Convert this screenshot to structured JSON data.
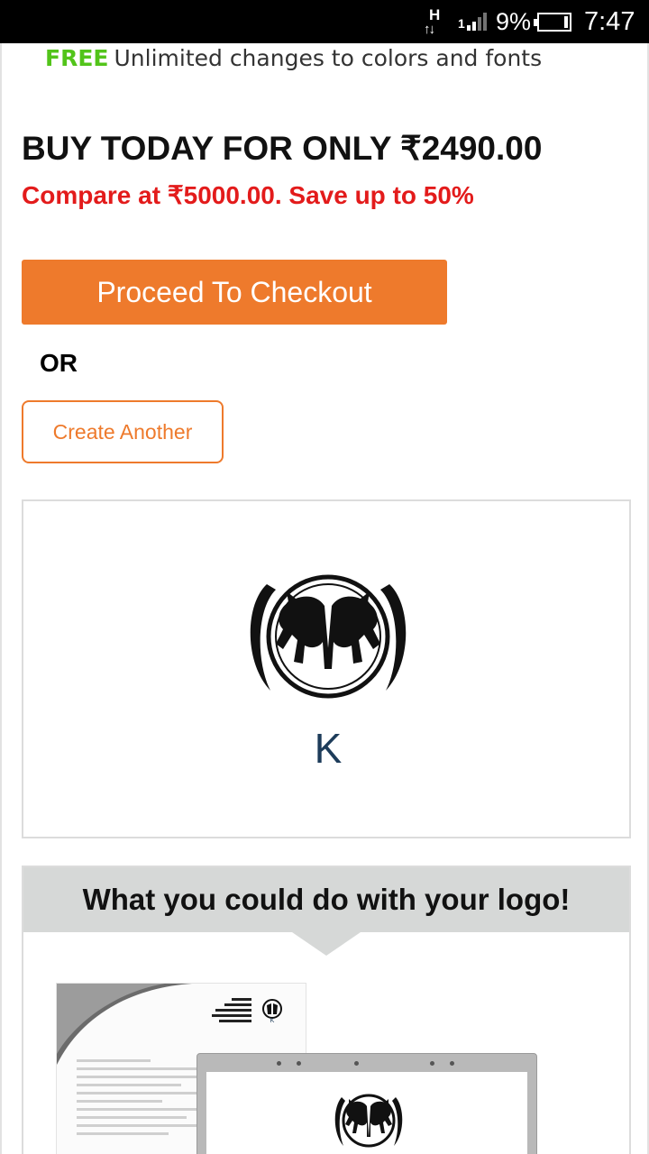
{
  "status_bar": {
    "network": "H",
    "signal_sub": "1",
    "battery_percent": "9%",
    "time": "7:47"
  },
  "promo": {
    "free_tag": "FREE",
    "free_text": "Unlimited changes to colors and fonts"
  },
  "pricing": {
    "headline": "BUY TODAY FOR ONLY ₹2490.00",
    "compare": "Compare at ₹5000.00. Save up to 50%"
  },
  "actions": {
    "checkout_label": "Proceed To Checkout",
    "or_label": "OR",
    "create_another_label": "Create Another"
  },
  "logo_preview": {
    "letter": "K",
    "emblem": "twin-horses-circle-logo",
    "letter_color": "#1d3c5a"
  },
  "uses": {
    "title": "What you could do with your logo!",
    "mockups": [
      "letterhead-mockup",
      "laptop-screen-mockup"
    ]
  },
  "colors": {
    "accent": "#ee7a2c",
    "free_green": "#52c41a",
    "compare_red": "#e31b1b",
    "section_header_bg": "#d6d8d7"
  }
}
